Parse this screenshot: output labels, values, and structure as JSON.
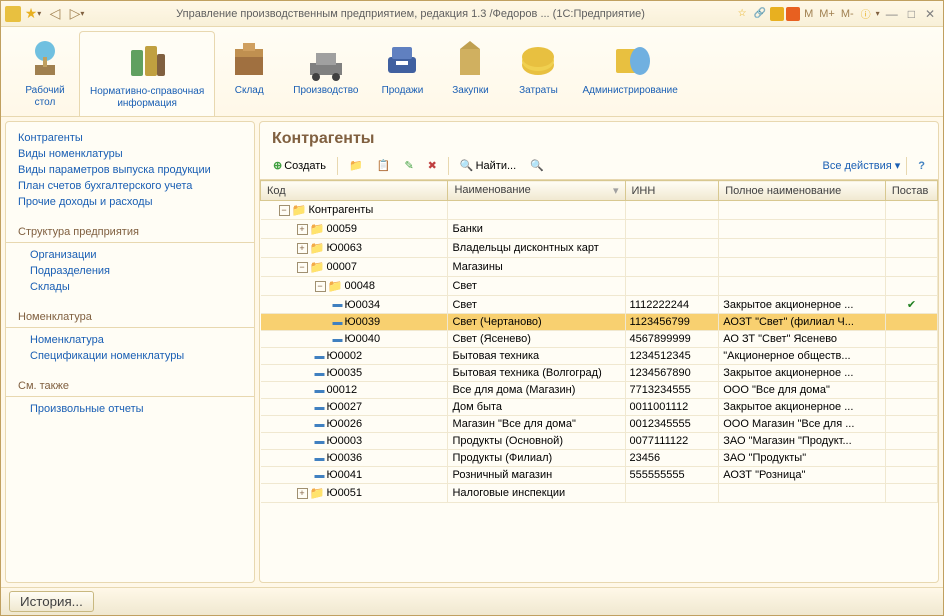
{
  "title": "Управление производственным предприятием, редакция 1.3 /Федоров ...   (1С:Предприятие)",
  "toolbar": [
    {
      "label": "Рабочий\nстол",
      "active": false
    },
    {
      "label": "Нормативно-справочная\nинформация",
      "active": true
    },
    {
      "label": "Склад",
      "active": false
    },
    {
      "label": "Производство",
      "active": false
    },
    {
      "label": "Продажи",
      "active": false
    },
    {
      "label": "Закупки",
      "active": false
    },
    {
      "label": "Затраты",
      "active": false
    },
    {
      "label": "Администрирование",
      "active": false
    }
  ],
  "sidebar": {
    "top": [
      "Контрагенты",
      "Виды номенклатуры",
      "Виды параметров выпуска продукции",
      "План счетов бухгалтерского учета",
      "Прочие доходы и расходы"
    ],
    "groups": [
      {
        "header": "Структура предприятия",
        "items": [
          "Организации",
          "Подразделения",
          "Склады"
        ]
      },
      {
        "header": "Номенклатура",
        "items": [
          "Номенклатура",
          "Спецификации номенклатуры"
        ]
      },
      {
        "header": "См. также",
        "items": [
          "Произвольные отчеты"
        ]
      }
    ]
  },
  "content": {
    "title": "Контрагенты",
    "create": "Создать",
    "find": "Найти...",
    "allActions": "Все действия"
  },
  "columns": [
    "Код",
    "Наименование",
    "ИНН",
    "Полное наименование",
    "Постав"
  ],
  "rows": [
    {
      "type": "folder",
      "level": 0,
      "toggle": "−",
      "code": "Контрагенты",
      "name": "",
      "inn": "",
      "full": ""
    },
    {
      "type": "folder",
      "level": 1,
      "toggle": "+",
      "code": "00059",
      "name": "Банки",
      "inn": "",
      "full": ""
    },
    {
      "type": "folder",
      "level": 1,
      "toggle": "+",
      "code": "Ю0063",
      "name": "Владельцы дисконтных карт",
      "inn": "",
      "full": ""
    },
    {
      "type": "folder",
      "level": 1,
      "toggle": "−",
      "code": "00007",
      "name": "Магазины",
      "inn": "",
      "full": ""
    },
    {
      "type": "folder",
      "level": 2,
      "toggle": "−",
      "code": "00048",
      "name": "Свет",
      "inn": "",
      "full": ""
    },
    {
      "type": "item",
      "level": 3,
      "code": "Ю0034",
      "name": "Свет",
      "inn": "1112222244",
      "full": "Закрытое акционерное ...",
      "check": true
    },
    {
      "type": "item",
      "level": 3,
      "code": "Ю0039",
      "name": "Свет (Чертаново)",
      "inn": "1123456799",
      "full": "АОЗТ \"Свет\" (филиал Ч...",
      "selected": true
    },
    {
      "type": "item",
      "level": 3,
      "code": "Ю0040",
      "name": "Свет (Ясенево)",
      "inn": "4567899999",
      "full": "АО ЗТ \"Свет\" Ясенево"
    },
    {
      "type": "item",
      "level": 2,
      "code": "Ю0002",
      "name": "Бытовая техника",
      "inn": "1234512345",
      "full": "\"Акционерное обществ..."
    },
    {
      "type": "item",
      "level": 2,
      "code": "Ю0035",
      "name": "Бытовая техника (Волгоград)",
      "inn": "1234567890",
      "full": "Закрытое акционерное ..."
    },
    {
      "type": "item",
      "level": 2,
      "code": "00012",
      "name": "Все для дома (Магазин)",
      "inn": "7713234555",
      "full": "ООО \"Все для дома\""
    },
    {
      "type": "item",
      "level": 2,
      "code": "Ю0027",
      "name": "Дом быта",
      "inn": "0011001112",
      "full": "Закрытое акционерное ..."
    },
    {
      "type": "item",
      "level": 2,
      "code": "Ю0026",
      "name": "Магазин \"Все для дома\"",
      "inn": "0012345555",
      "full": "ООО Магазин \"Все для ..."
    },
    {
      "type": "item",
      "level": 2,
      "code": "Ю0003",
      "name": "Продукты (Основной)",
      "inn": "0077111122",
      "full": "ЗАО \"Магазин \"Продукт..."
    },
    {
      "type": "item",
      "level": 2,
      "code": "Ю0036",
      "name": "Продукты (Филиал)",
      "inn": "23456",
      "full": "ЗАО \"Продукты\""
    },
    {
      "type": "item",
      "level": 2,
      "code": "Ю0041",
      "name": "Розничный магазин",
      "inn": "555555555",
      "full": "АОЗТ \"Розница\""
    },
    {
      "type": "folder",
      "level": 1,
      "toggle": "+",
      "code": "Ю0051",
      "name": "Налоговые инспекции",
      "inn": "",
      "full": ""
    }
  ],
  "footer": {
    "history": "История..."
  }
}
